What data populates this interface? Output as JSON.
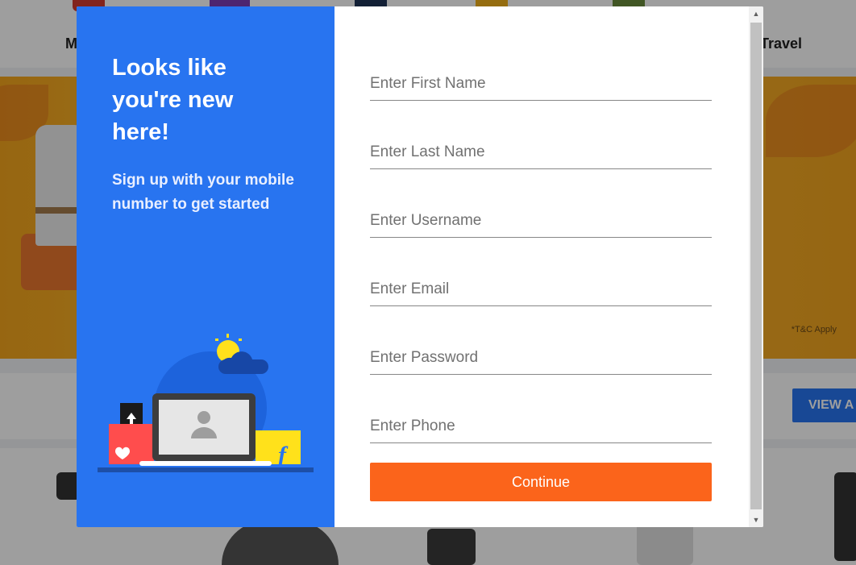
{
  "background": {
    "nav_left_label": "M",
    "nav_right_label": "Travel",
    "banner_tc": "*T&C Apply",
    "view_all_label": "VIEW A"
  },
  "signup": {
    "title": "Looks like you're new here!",
    "subtitle": "Sign up with your mobile number to get started",
    "fields": [
      {
        "name": "first-name-field",
        "placeholder": "Enter First Name",
        "value": ""
      },
      {
        "name": "last-name-field",
        "placeholder": "Enter Last Name",
        "value": ""
      },
      {
        "name": "username-field",
        "placeholder": "Enter Username",
        "value": ""
      },
      {
        "name": "email-field",
        "placeholder": "Enter Email",
        "value": ""
      },
      {
        "name": "password-field",
        "placeholder": "Enter Password",
        "value": ""
      },
      {
        "name": "phone-field",
        "placeholder": "Enter Phone",
        "value": ""
      }
    ],
    "continue_label": "Continue"
  },
  "icons": {
    "illustration": "laptop-login-illustration",
    "scroll_up": "triangle-up-icon",
    "scroll_down": "triangle-down-icon"
  },
  "colors": {
    "brand_blue": "#2874f0",
    "cta_orange": "#fb641b",
    "flipkart_yellow": "#ffe11b"
  }
}
